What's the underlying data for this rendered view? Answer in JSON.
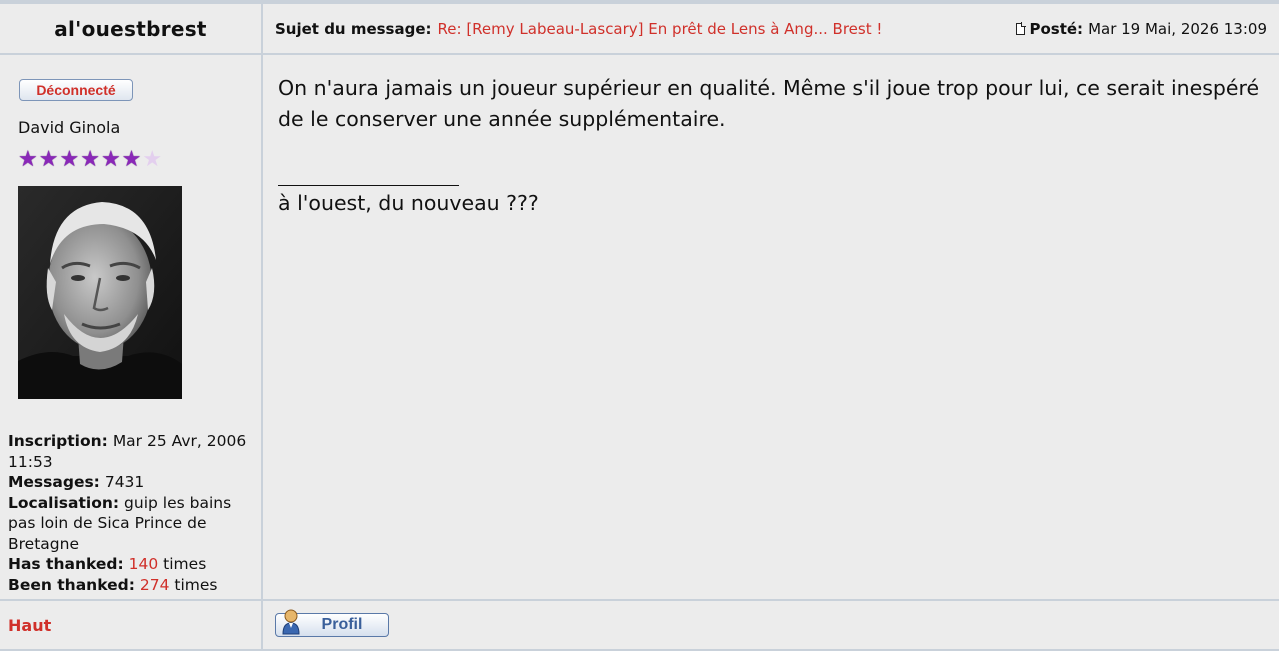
{
  "post": {
    "author": "al'ouestbrest",
    "subject_label": "Sujet du message:",
    "subject": "Re: [Remy Labeau-Lascary] En prêt de Lens à Ang... Brest !",
    "posted_label": "Posté:",
    "posted_date": "Mar 19 Mai, 2026 13:09",
    "body": "On n'aura jamais un joueur supérieur en qualité. Même s'il joue trop pour lui, ce serait inespéré de le conserver une année supplémentaire.",
    "signature": "à l'ouest, du nouveau ???"
  },
  "profile": {
    "status": "Déconnecté",
    "rank": "David Ginola",
    "stars_filled": 6,
    "stars_total": 7,
    "stats": {
      "inscription_label": "Inscription:",
      "inscription": "Mar 25 Avr, 2006 11:53",
      "messages_label": "Messages:",
      "messages": "7431",
      "localisation_label": "Localisation:",
      "localisation": "guip les bains pas loin de Sica Prince de Bretagne",
      "has_thanked_label": "Has thanked:",
      "has_thanked": "140",
      "been_thanked_label": "Been thanked:",
      "been_thanked": "274",
      "times": "times"
    }
  },
  "footer": {
    "top_link": "Haut",
    "profile_button": "Profil"
  },
  "colors": {
    "accent_red": "#d0302a",
    "star_purple": "#8a28b8",
    "cell_bg": "#ececec",
    "border": "#c9d1da"
  }
}
